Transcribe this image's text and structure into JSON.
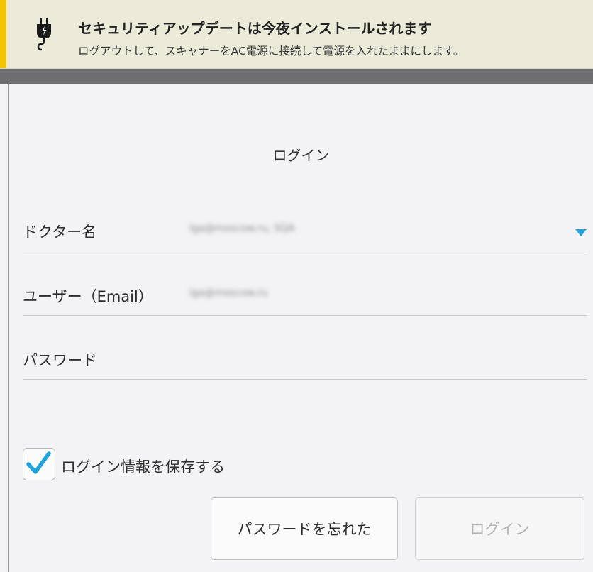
{
  "banner": {
    "title": "セキュリティアップデートは今夜インストールされます",
    "message": "ログアウトして、スキャナーをAC電源に接続して電源を入れたままにします。",
    "icon": "plug-icon",
    "accent_color": "#f5c400"
  },
  "login": {
    "title": "ログイン",
    "fields": [
      {
        "label": "ドクター名",
        "value": "lga@moscow.ru, SQA"
      },
      {
        "label": "ユーザー（Email）",
        "value": "lga@moscow.ru"
      },
      {
        "label": "パスワード",
        "value": ""
      }
    ],
    "dropdown_icon": "chevron-down-icon",
    "dropdown_color": "#1fa3dc",
    "remember": {
      "label": "ログイン情報を保存する",
      "checked": true,
      "check_color": "#1fa3dc"
    },
    "buttons": {
      "forgot": "パスワードを忘れた",
      "login": "ログイン"
    }
  }
}
